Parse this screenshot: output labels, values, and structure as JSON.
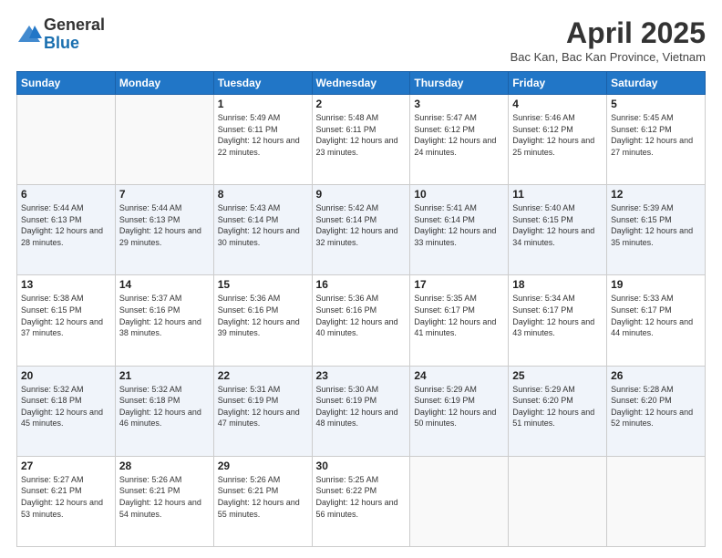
{
  "logo": {
    "general": "General",
    "blue": "Blue"
  },
  "title": "April 2025",
  "location": "Bac Kan, Bac Kan Province, Vietnam",
  "days_of_week": [
    "Sunday",
    "Monday",
    "Tuesday",
    "Wednesday",
    "Thursday",
    "Friday",
    "Saturday"
  ],
  "weeks": [
    [
      {
        "day": "",
        "sunrise": "",
        "sunset": "",
        "daylight": ""
      },
      {
        "day": "",
        "sunrise": "",
        "sunset": "",
        "daylight": ""
      },
      {
        "day": "1",
        "sunrise": "Sunrise: 5:49 AM",
        "sunset": "Sunset: 6:11 PM",
        "daylight": "Daylight: 12 hours and 22 minutes."
      },
      {
        "day": "2",
        "sunrise": "Sunrise: 5:48 AM",
        "sunset": "Sunset: 6:11 PM",
        "daylight": "Daylight: 12 hours and 23 minutes."
      },
      {
        "day": "3",
        "sunrise": "Sunrise: 5:47 AM",
        "sunset": "Sunset: 6:12 PM",
        "daylight": "Daylight: 12 hours and 24 minutes."
      },
      {
        "day": "4",
        "sunrise": "Sunrise: 5:46 AM",
        "sunset": "Sunset: 6:12 PM",
        "daylight": "Daylight: 12 hours and 25 minutes."
      },
      {
        "day": "5",
        "sunrise": "Sunrise: 5:45 AM",
        "sunset": "Sunset: 6:12 PM",
        "daylight": "Daylight: 12 hours and 27 minutes."
      }
    ],
    [
      {
        "day": "6",
        "sunrise": "Sunrise: 5:44 AM",
        "sunset": "Sunset: 6:13 PM",
        "daylight": "Daylight: 12 hours and 28 minutes."
      },
      {
        "day": "7",
        "sunrise": "Sunrise: 5:44 AM",
        "sunset": "Sunset: 6:13 PM",
        "daylight": "Daylight: 12 hours and 29 minutes."
      },
      {
        "day": "8",
        "sunrise": "Sunrise: 5:43 AM",
        "sunset": "Sunset: 6:14 PM",
        "daylight": "Daylight: 12 hours and 30 minutes."
      },
      {
        "day": "9",
        "sunrise": "Sunrise: 5:42 AM",
        "sunset": "Sunset: 6:14 PM",
        "daylight": "Daylight: 12 hours and 32 minutes."
      },
      {
        "day": "10",
        "sunrise": "Sunrise: 5:41 AM",
        "sunset": "Sunset: 6:14 PM",
        "daylight": "Daylight: 12 hours and 33 minutes."
      },
      {
        "day": "11",
        "sunrise": "Sunrise: 5:40 AM",
        "sunset": "Sunset: 6:15 PM",
        "daylight": "Daylight: 12 hours and 34 minutes."
      },
      {
        "day": "12",
        "sunrise": "Sunrise: 5:39 AM",
        "sunset": "Sunset: 6:15 PM",
        "daylight": "Daylight: 12 hours and 35 minutes."
      }
    ],
    [
      {
        "day": "13",
        "sunrise": "Sunrise: 5:38 AM",
        "sunset": "Sunset: 6:15 PM",
        "daylight": "Daylight: 12 hours and 37 minutes."
      },
      {
        "day": "14",
        "sunrise": "Sunrise: 5:37 AM",
        "sunset": "Sunset: 6:16 PM",
        "daylight": "Daylight: 12 hours and 38 minutes."
      },
      {
        "day": "15",
        "sunrise": "Sunrise: 5:36 AM",
        "sunset": "Sunset: 6:16 PM",
        "daylight": "Daylight: 12 hours and 39 minutes."
      },
      {
        "day": "16",
        "sunrise": "Sunrise: 5:36 AM",
        "sunset": "Sunset: 6:16 PM",
        "daylight": "Daylight: 12 hours and 40 minutes."
      },
      {
        "day": "17",
        "sunrise": "Sunrise: 5:35 AM",
        "sunset": "Sunset: 6:17 PM",
        "daylight": "Daylight: 12 hours and 41 minutes."
      },
      {
        "day": "18",
        "sunrise": "Sunrise: 5:34 AM",
        "sunset": "Sunset: 6:17 PM",
        "daylight": "Daylight: 12 hours and 43 minutes."
      },
      {
        "day": "19",
        "sunrise": "Sunrise: 5:33 AM",
        "sunset": "Sunset: 6:17 PM",
        "daylight": "Daylight: 12 hours and 44 minutes."
      }
    ],
    [
      {
        "day": "20",
        "sunrise": "Sunrise: 5:32 AM",
        "sunset": "Sunset: 6:18 PM",
        "daylight": "Daylight: 12 hours and 45 minutes."
      },
      {
        "day": "21",
        "sunrise": "Sunrise: 5:32 AM",
        "sunset": "Sunset: 6:18 PM",
        "daylight": "Daylight: 12 hours and 46 minutes."
      },
      {
        "day": "22",
        "sunrise": "Sunrise: 5:31 AM",
        "sunset": "Sunset: 6:19 PM",
        "daylight": "Daylight: 12 hours and 47 minutes."
      },
      {
        "day": "23",
        "sunrise": "Sunrise: 5:30 AM",
        "sunset": "Sunset: 6:19 PM",
        "daylight": "Daylight: 12 hours and 48 minutes."
      },
      {
        "day": "24",
        "sunrise": "Sunrise: 5:29 AM",
        "sunset": "Sunset: 6:19 PM",
        "daylight": "Daylight: 12 hours and 50 minutes."
      },
      {
        "day": "25",
        "sunrise": "Sunrise: 5:29 AM",
        "sunset": "Sunset: 6:20 PM",
        "daylight": "Daylight: 12 hours and 51 minutes."
      },
      {
        "day": "26",
        "sunrise": "Sunrise: 5:28 AM",
        "sunset": "Sunset: 6:20 PM",
        "daylight": "Daylight: 12 hours and 52 minutes."
      }
    ],
    [
      {
        "day": "27",
        "sunrise": "Sunrise: 5:27 AM",
        "sunset": "Sunset: 6:21 PM",
        "daylight": "Daylight: 12 hours and 53 minutes."
      },
      {
        "day": "28",
        "sunrise": "Sunrise: 5:26 AM",
        "sunset": "Sunset: 6:21 PM",
        "daylight": "Daylight: 12 hours and 54 minutes."
      },
      {
        "day": "29",
        "sunrise": "Sunrise: 5:26 AM",
        "sunset": "Sunset: 6:21 PM",
        "daylight": "Daylight: 12 hours and 55 minutes."
      },
      {
        "day": "30",
        "sunrise": "Sunrise: 5:25 AM",
        "sunset": "Sunset: 6:22 PM",
        "daylight": "Daylight: 12 hours and 56 minutes."
      },
      {
        "day": "",
        "sunrise": "",
        "sunset": "",
        "daylight": ""
      },
      {
        "day": "",
        "sunrise": "",
        "sunset": "",
        "daylight": ""
      },
      {
        "day": "",
        "sunrise": "",
        "sunset": "",
        "daylight": ""
      }
    ]
  ]
}
